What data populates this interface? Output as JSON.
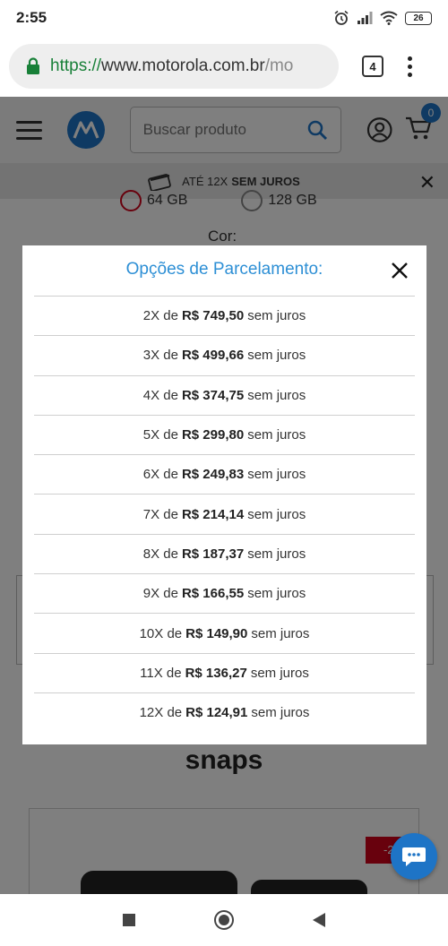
{
  "status_bar": {
    "time": "2:55",
    "battery": "26"
  },
  "browser": {
    "url_scheme": "https://",
    "url_host": "www.motorola.com.br",
    "url_rest": "/mo",
    "tab_count": "4"
  },
  "header": {
    "search_placeholder": "Buscar produto",
    "cart_count": "0"
  },
  "promo": {
    "text": "ATÉ 12X",
    "bold": "SEM JUROS"
  },
  "page": {
    "color_label": "Cor:",
    "storage_options": [
      "64 GB",
      "128 GB"
    ],
    "section_title": "snaps",
    "tag_text": "-2"
  },
  "modal": {
    "title": "Opções de Parcelamento:",
    "installments": [
      {
        "count": "2X de",
        "amount": "R$ 749,50",
        "suffix": "sem juros"
      },
      {
        "count": "3X de",
        "amount": "R$ 499,66",
        "suffix": "sem juros"
      },
      {
        "count": "4X de",
        "amount": "R$ 374,75",
        "suffix": "sem juros"
      },
      {
        "count": "5X de",
        "amount": "R$ 299,80",
        "suffix": "sem juros"
      },
      {
        "count": "6X de",
        "amount": "R$ 249,83",
        "suffix": "sem juros"
      },
      {
        "count": "7X de",
        "amount": "R$ 214,14",
        "suffix": "sem juros"
      },
      {
        "count": "8X de",
        "amount": "R$ 187,37",
        "suffix": "sem juros"
      },
      {
        "count": "9X de",
        "amount": "R$ 166,55",
        "suffix": "sem juros"
      },
      {
        "count": "10X de",
        "amount": "R$ 149,90",
        "suffix": "sem juros"
      },
      {
        "count": "11X de",
        "amount": "R$ 136,27",
        "suffix": "sem juros"
      },
      {
        "count": "12X de",
        "amount": "R$ 124,91",
        "suffix": "sem juros"
      }
    ]
  },
  "colors": {
    "accent": "#1e74c6",
    "title_blue": "#2d8fd5",
    "secure_green": "#188038",
    "sale_red": "#d0021b"
  },
  "icons": [
    "alarm-icon",
    "signal-icon",
    "wifi-icon",
    "battery-icon",
    "lock-icon",
    "menu-icon",
    "motorola-logo",
    "search-icon",
    "user-icon",
    "cart-icon",
    "card-icon",
    "close-icon",
    "chat-icon"
  ]
}
